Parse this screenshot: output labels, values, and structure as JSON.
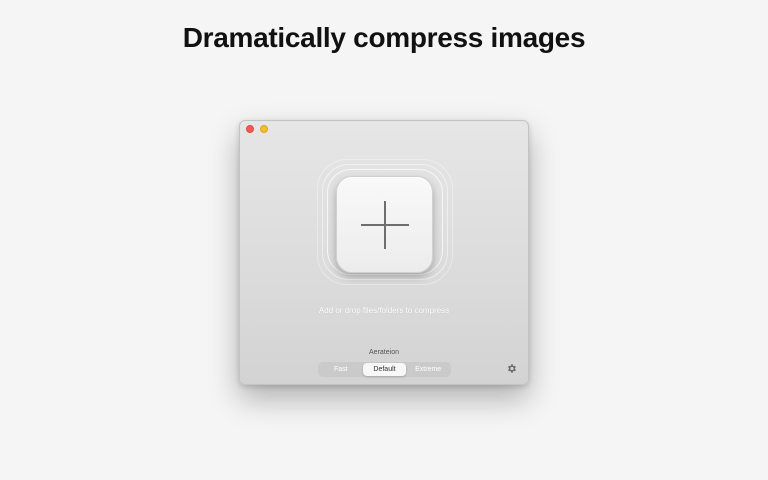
{
  "headline": "Dramatically compress images",
  "window": {
    "traffic_lights": [
      "close",
      "minimize"
    ],
    "drop_zone": {
      "icon": "plus-icon",
      "hint": "Add or drop files/folders to compress"
    },
    "mode": {
      "title": "Aerateion",
      "options": [
        "Fast",
        "Default",
        "Extreme"
      ],
      "selected": "Default"
    },
    "settings_icon": "gear-icon"
  },
  "colors": {
    "close": "#f25a52",
    "minimize": "#f5bd2c",
    "window_bg": "#dcdcdc"
  }
}
